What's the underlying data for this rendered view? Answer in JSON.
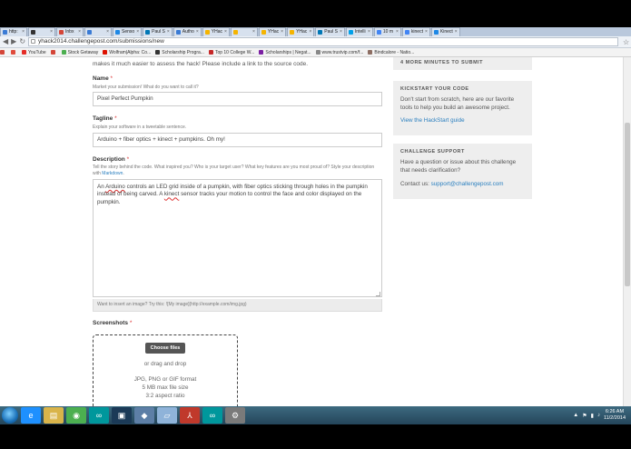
{
  "browser": {
    "tabs": [
      {
        "label": "http:",
        "color": "#3a7bd5"
      },
      {
        "label": "",
        "color": "#333333"
      },
      {
        "label": "Inbx",
        "color": "#d44638"
      },
      {
        "label": "",
        "color": "#3a7bd5"
      },
      {
        "label": "Senso",
        "color": "#1e88e5"
      },
      {
        "label": "Paul S",
        "color": "#0077b5"
      },
      {
        "label": "Autho",
        "color": "#3a7bd5"
      },
      {
        "label": "YHac",
        "color": "#f5b400"
      },
      {
        "label": "",
        "color": "#f5b400"
      },
      {
        "label": "YHac",
        "color": "#f5b400"
      },
      {
        "label": "YHac",
        "color": "#f5b400"
      },
      {
        "label": "Paul S",
        "color": "#0077b5"
      },
      {
        "label": "Intelli",
        "color": "#00a0e9"
      },
      {
        "label": "10 m",
        "color": "#4285f4"
      },
      {
        "label": "kinect",
        "color": "#4285f4"
      },
      {
        "label": "Kinect",
        "color": "#1e88e5"
      }
    ],
    "url": "yhack2014.challengepost.com/submissions/new",
    "bookmarks": [
      {
        "label": "",
        "color": "#d44638"
      },
      {
        "label": "",
        "color": "#e04b3c"
      },
      {
        "label": "YouTube",
        "color": "#e52d27"
      },
      {
        "label": "",
        "color": "#d44638"
      },
      {
        "label": "Stock Getaway",
        "color": "#4caf50"
      },
      {
        "label": "Wolfram|Alpha: Co...",
        "color": "#dd1100"
      },
      {
        "label": "Scholarship Progra...",
        "color": "#333333"
      },
      {
        "label": "Top 10 College W...",
        "color": "#c62828"
      },
      {
        "label": "Scholarships | Negat...",
        "color": "#7b1fa2"
      },
      {
        "label": "www.trustvip.com/f...",
        "color": "#888888"
      },
      {
        "label": "Bindcalore - Natio...",
        "color": "#8d6e63"
      }
    ]
  },
  "form": {
    "intro_text": "makes it much easier to assess the hack! Please include a link to the source code.",
    "name": {
      "label": "Name",
      "required_mark": "*",
      "help": "Market your submission! What do you want to call it?",
      "value": "Pixel Perfect Pumpkin"
    },
    "tagline": {
      "label": "Tagline",
      "required_mark": "*",
      "help": "Explain your software in a tweetable sentence.",
      "value": "Arduino + fiber optics + kinect + pumpkins. Oh my!"
    },
    "description": {
      "label": "Description",
      "required_mark": "*",
      "help": "Tell the story behind the code. What inspired you? Who is your target user? What key features are you most proud of? Style your description with",
      "help_link": "Markdown",
      "help_end": ".",
      "value": {
        "w1": "An",
        "arduino": "Arduino",
        "w2": "controls an LED grid inside of a pumpkin, with fiber optics sticking through holes in the pumpkin instead of being carved.  A",
        "kinect": "kinect",
        "w3": "sensor tracks your motion to control the face and color displayed on the pumpkin."
      },
      "footer": "Want to insert an image? Try this: ![My image](http://example.com/img.jpg)"
    },
    "screenshots": {
      "label": "Screenshots",
      "required_mark": "*",
      "choose_button": "Choose files",
      "or_text": "or drag and drop",
      "formats": "JPG, PNG or GIF format",
      "max_size": "5 MB max file size",
      "aspect": "3:2 aspect ratio"
    }
  },
  "sidebar": {
    "minutes_banner": "4 MORE MINUTES TO SUBMIT",
    "kickstart": {
      "title": "KICKSTART YOUR CODE",
      "text": "Don't start from scratch, here are our favorite tools to help you build an awesome project.",
      "link": "View the HackStart guide"
    },
    "support": {
      "title": "CHALLENGE SUPPORT",
      "text": "Have a question or issue about this challenge that needs clarification?",
      "contact_label": "Contact us:",
      "contact_link": "support@challengepost.com"
    }
  },
  "taskbar": {
    "apps": [
      {
        "name": "internet-explorer-icon",
        "color": "#1e90ff",
        "glyph": "e"
      },
      {
        "name": "file-explorer-icon",
        "color": "#d9b44a",
        "glyph": "▤"
      },
      {
        "name": "chrome-icon",
        "color": "#4caf50",
        "glyph": "◉"
      },
      {
        "name": "arduino-icon",
        "color": "#00979c",
        "glyph": "∞"
      },
      {
        "name": "terminal-icon",
        "color": "#1b3a57",
        "glyph": "▣"
      },
      {
        "name": "app-icon",
        "color": "#5d7fa6",
        "glyph": "◆"
      },
      {
        "name": "notes-icon",
        "color": "#8fb3d9",
        "glyph": "▱"
      },
      {
        "name": "acrobat-icon",
        "color": "#c0392b",
        "glyph": "⅄"
      },
      {
        "name": "arduino-2-icon",
        "color": "#00979c",
        "glyph": "∞"
      },
      {
        "name": "settings-icon",
        "color": "#7a7a7a",
        "glyph": "⚙"
      }
    ],
    "time": "6:26 AM",
    "date": "11/2/2014"
  }
}
